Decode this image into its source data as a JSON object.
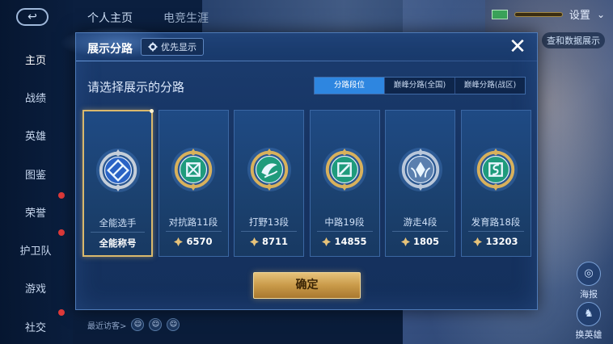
{
  "background": {
    "top_tabs": [
      "个人主页",
      "电竞生涯"
    ],
    "nav_items": [
      "主页",
      "战绩",
      "英雄",
      "图鉴",
      "荣誉",
      "护卫队",
      "游戏",
      "社交"
    ],
    "settings_label": "设置",
    "side_link": "查和数据展示",
    "right_buttons": [
      {
        "label": "海报"
      },
      {
        "label": "换英雄"
      }
    ],
    "recent_visitors": "最近访客>"
  },
  "dialog": {
    "title": "展示分路",
    "pref_label": "优先显示",
    "close_glyph": "✕",
    "prompt": "请选择展示的分路",
    "tabs": [
      {
        "label": "分路段位",
        "active": true
      },
      {
        "label": "巅峰分路(全国)",
        "active": false
      },
      {
        "label": "巅峰分路(战区)",
        "active": false
      }
    ],
    "cards": [
      {
        "name": "全能选手",
        "value": "全能称号",
        "show_gem": false,
        "selected": true,
        "icon": "all-round-badge-icon",
        "ring": "#c5ced9",
        "core": "#2a63c5"
      },
      {
        "name": "对抗路11段",
        "value": "6570",
        "show_gem": true,
        "selected": false,
        "icon": "clash-lane-badge-icon",
        "ring": "#d8b15c",
        "core": "#1f9b7c"
      },
      {
        "name": "打野13段",
        "value": "8711",
        "show_gem": true,
        "selected": false,
        "icon": "jungle-badge-icon",
        "ring": "#d8b15c",
        "core": "#1f9b7c"
      },
      {
        "name": "中路19段",
        "value": "14855",
        "show_gem": true,
        "selected": false,
        "icon": "mid-lane-badge-icon",
        "ring": "#d8b15c",
        "core": "#1f9b7c"
      },
      {
        "name": "游走4段",
        "value": "1805",
        "show_gem": true,
        "selected": false,
        "icon": "roam-badge-icon",
        "ring": "#b9c7da",
        "core": "#5a7fae"
      },
      {
        "name": "发育路18段",
        "value": "13203",
        "show_gem": true,
        "selected": false,
        "icon": "farm-lane-badge-icon",
        "ring": "#d8b15c",
        "core": "#1f9b7c"
      }
    ],
    "confirm_label": "确定"
  },
  "colors": {
    "accent_blue": "#2e86e0",
    "gold": "#d9b86c"
  }
}
